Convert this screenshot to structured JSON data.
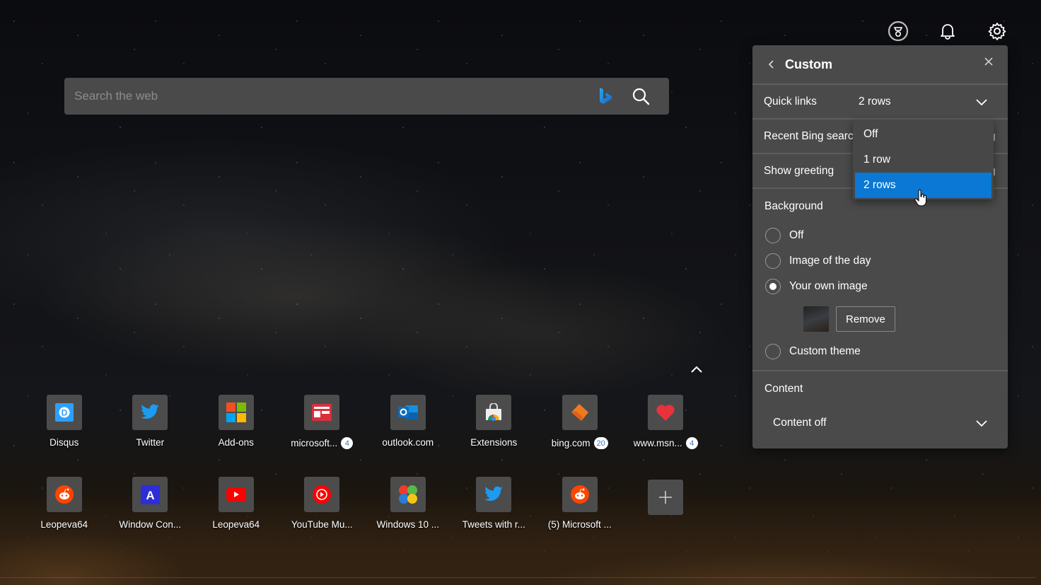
{
  "header_icons": [
    {
      "name": "rewards",
      "icon": "rewards-icon"
    },
    {
      "name": "notifications",
      "icon": "bell-icon"
    },
    {
      "name": "settings",
      "icon": "gear-icon"
    }
  ],
  "search": {
    "placeholder": "Search the web",
    "value": "",
    "bing_icon": "bing-logo-icon",
    "search_icon": "search-icon"
  },
  "quick_links": {
    "rows": [
      [
        {
          "label": "Disqus",
          "icon": "disqus-icon"
        },
        {
          "label": "Twitter",
          "icon": "twitter-icon"
        },
        {
          "label": "Add-ons",
          "icon": "microsoft-logo-icon"
        },
        {
          "label": "microsoft...",
          "icon": "news-icon",
          "badge": "4"
        },
        {
          "label": "outlook.com",
          "icon": "outlook-icon"
        },
        {
          "label": "Extensions",
          "icon": "chrome-webstore-icon"
        },
        {
          "label": "bing.com",
          "icon": "bing-orange-icon",
          "badge": "20"
        },
        {
          "label": "www.msn...",
          "icon": "heart-icon",
          "badge": "4"
        }
      ],
      [
        {
          "label": "Leopeva64",
          "icon": "reddit-icon"
        },
        {
          "label": "Window Con...",
          "icon": "letter-a-icon"
        },
        {
          "label": "Leopeva64",
          "icon": "youtube-icon"
        },
        {
          "label": "YouTube Mu...",
          "icon": "youtube-music-icon"
        },
        {
          "label": "Windows 10 ...",
          "icon": "windows-flag-icon"
        },
        {
          "label": "Tweets with r...",
          "icon": "twitter-icon"
        },
        {
          "label": "(5) Microsoft ...",
          "icon": "reddit-icon"
        }
      ]
    ],
    "add_icon": "plus-icon"
  },
  "panel": {
    "title": "Custom",
    "back_icon": "chevron-left-icon",
    "close_icon": "close-icon",
    "quick_links": {
      "label": "Quick links",
      "value": "2 rows"
    },
    "recent_bing": {
      "label": "Recent Bing searches"
    },
    "show_greeting": {
      "label": "Show greeting"
    },
    "background": {
      "label": "Background",
      "options": [
        {
          "label": "Off",
          "selected": false
        },
        {
          "label": "Image of the day",
          "selected": false
        },
        {
          "label": "Your own image",
          "selected": true
        },
        {
          "label": "Custom theme",
          "selected": false
        }
      ],
      "remove_label": "Remove"
    },
    "content": {
      "label": "Content",
      "value": "Content off"
    }
  },
  "dropdown": {
    "options": [
      "Off",
      "1 row",
      "2 rows"
    ],
    "selected": "2 rows"
  },
  "colors": {
    "accent": "#0a78d4",
    "panel_bg": "#4a4a4a",
    "tile_bg": "#4c4c4c"
  }
}
